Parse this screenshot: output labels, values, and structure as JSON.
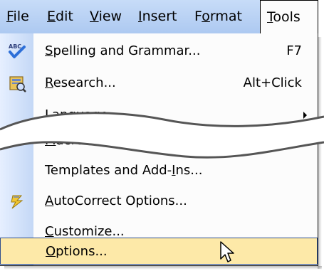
{
  "menubar": {
    "menus": [
      {
        "pre": "",
        "mn": "F",
        "post": "ile"
      },
      {
        "pre": "",
        "mn": "E",
        "post": "dit"
      },
      {
        "pre": "",
        "mn": "V",
        "post": "iew"
      },
      {
        "pre": "",
        "mn": "I",
        "post": "nsert"
      },
      {
        "pre": "F",
        "mn": "o",
        "post": "rmat"
      },
      {
        "pre": "",
        "mn": "T",
        "post": "ools"
      }
    ]
  },
  "tools_menu": {
    "items": [
      {
        "pre": "",
        "mn": "S",
        "post": "pelling and Grammar...",
        "shortcut": "F7",
        "icon": "spelling-icon"
      },
      {
        "pre": "",
        "mn": "R",
        "post": "esearch...",
        "shortcut": "Alt+Click",
        "icon": "research-icon"
      },
      {
        "pre": "",
        "mn": "L",
        "post": "anguage",
        "submenu": true
      },
      {
        "pre": "",
        "mn": "M",
        "post": "acro",
        "submenu": true
      },
      {
        "pre": "Templates and Add-",
        "mn": "I",
        "post": "ns..."
      },
      {
        "pre": "",
        "mn": "A",
        "post": "utoCorrect Options...",
        "icon": "autocorrect-icon"
      },
      {
        "pre": "",
        "mn": "C",
        "post": "ustomize..."
      },
      {
        "pre": "",
        "mn": "O",
        "post": "ptions...",
        "highlighted": true
      }
    ]
  },
  "colors": {
    "menubar": "#b9d2f4",
    "icon_column": "#d6e4fa",
    "highlight": "#fde9a8",
    "highlight_border": "#2e4e8c"
  },
  "cursor_icon": "arrow-cursor-icon"
}
